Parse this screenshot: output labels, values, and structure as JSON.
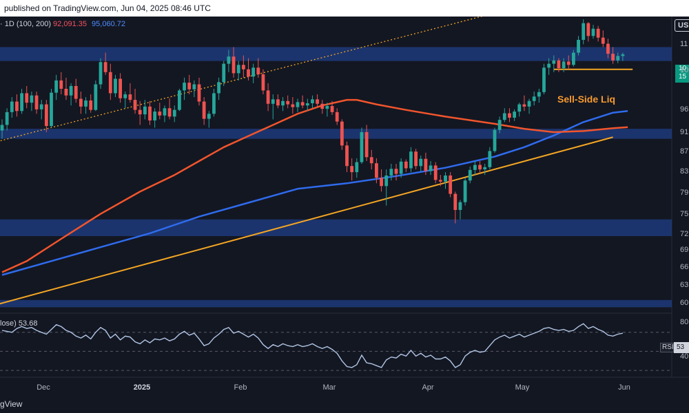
{
  "header": {
    "text": "published on TradingView.com, Jun 04, 2025 08:46 UTC"
  },
  "footer": {
    "text": "gView"
  },
  "legend": {
    "prefix": "· 1D (100, 200)",
    "ma100": "92,091.35",
    "ma200": "95,060.72"
  },
  "currency": "US",
  "price_tag": {
    "line1": "10",
    "line2": "15"
  },
  "annotation": "Sell-Side Liq",
  "rsi": {
    "legend_label": "lose)",
    "legend_value": "53.68",
    "tag": "RSI",
    "value": "53"
  },
  "colors": {
    "bg": "#131722",
    "zone": "#1e3a7a",
    "ma100": "#f2552c",
    "ma200": "#2f6bed",
    "trend": "#f5a623",
    "up": "#26a69a",
    "down": "#ef5350",
    "rsi_line": "#b2c7e6"
  },
  "chart_data": [
    {
      "type": "candlestick",
      "title": "",
      "x_tick_labels": [
        "Dec",
        "2025",
        "Feb",
        "Mar",
        "Apr",
        "May",
        "Jun"
      ],
      "y_tick_labels": [
        "11",
        "10",
        "96",
        "91",
        "87",
        "83",
        "79",
        "75",
        "72",
        "69",
        "66",
        "63",
        "60"
      ],
      "ylim": [
        59000,
        112000
      ],
      "zones": [
        {
          "from": 104000,
          "to": 106500
        },
        {
          "from": 90000,
          "to": 91800
        },
        {
          "from": 72500,
          "to": 75500
        },
        {
          "from": 59700,
          "to": 61000
        }
      ],
      "ohlc": [
        [
          91500,
          93500,
          90000,
          92500
        ],
        [
          92500,
          95500,
          91500,
          94800
        ],
        [
          94800,
          97500,
          93800,
          96700
        ],
        [
          96700,
          98000,
          94000,
          95000
        ],
        [
          95000,
          99000,
          94500,
          98200
        ],
        [
          98200,
          99500,
          95500,
          96500
        ],
        [
          96500,
          98500,
          95000,
          97800
        ],
        [
          97800,
          98500,
          94500,
          95300
        ],
        [
          95300,
          97000,
          93500,
          96200
        ],
        [
          96200,
          97000,
          91200,
          92300
        ],
        [
          92300,
          99000,
          92000,
          98300
        ],
        [
          98300,
          101500,
          97000,
          100500
        ],
        [
          100500,
          102000,
          98000,
          99000
        ],
        [
          99000,
          101000,
          97000,
          97800
        ],
        [
          97800,
          100000,
          96000,
          99500
        ],
        [
          99500,
          100800,
          96500,
          97200
        ],
        [
          97200,
          98500,
          94500,
          95800
        ],
        [
          95800,
          97500,
          94500,
          96900
        ],
        [
          96900,
          98000,
          94700,
          95200
        ],
        [
          95200,
          100500,
          95000,
          99800
        ],
        [
          99800,
          104500,
          99000,
          103800
        ],
        [
          103800,
          105500,
          101500,
          102000
        ],
        [
          102000,
          103500,
          97000,
          98200
        ],
        [
          98200,
          101500,
          97500,
          100800
        ],
        [
          100800,
          101800,
          96500,
          97300
        ],
        [
          97300,
          98500,
          95500,
          98000
        ],
        [
          98000,
          100000,
          96500,
          97000
        ],
        [
          97000,
          99000,
          94500,
          95200
        ],
        [
          95200,
          96800,
          92500,
          94400
        ],
        [
          94400,
          97000,
          93500,
          95800
        ],
        [
          95800,
          96800,
          92500,
          93300
        ],
        [
          93300,
          95500,
          92000,
          94900
        ],
        [
          94900,
          96500,
          93500,
          94200
        ],
        [
          94200,
          96000,
          93000,
          95500
        ],
        [
          95500,
          97300,
          93500,
          94000
        ],
        [
          94000,
          96000,
          93000,
          95200
        ],
        [
          95200,
          99000,
          95000,
          98700
        ],
        [
          98700,
          101000,
          97000,
          100100
        ],
        [
          100100,
          101500,
          98000,
          98900
        ],
        [
          98900,
          100500,
          97500,
          99800
        ],
        [
          99800,
          101000,
          96000,
          96700
        ],
        [
          96700,
          97500,
          92500,
          93600
        ],
        [
          93600,
          95000,
          92000,
          94500
        ],
        [
          94500,
          99000,
          94000,
          98200
        ],
        [
          98200,
          101000,
          97000,
          100200
        ],
        [
          100200,
          104000,
          99500,
          103500
        ],
        [
          103500,
          106000,
          102000,
          104800
        ],
        [
          104800,
          106500,
          101000,
          101800
        ],
        [
          101800,
          104000,
          100500,
          103300
        ],
        [
          103300,
          105000,
          101000,
          102500
        ],
        [
          102500,
          104500,
          100500,
          101200
        ],
        [
          101200,
          103500,
          100000,
          102800
        ],
        [
          102800,
          104500,
          101000,
          101600
        ],
        [
          101600,
          102500,
          98000,
          98700
        ],
        [
          98700,
          100000,
          95000,
          96300
        ],
        [
          96300,
          98000,
          93500,
          97100
        ],
        [
          97100,
          98000,
          95500,
          96000
        ],
        [
          96000,
          97500,
          95000,
          96800
        ],
        [
          96800,
          97800,
          95500,
          96200
        ],
        [
          96200,
          97500,
          94500,
          95700
        ],
        [
          95700,
          97200,
          94800,
          96600
        ],
        [
          96600,
          97800,
          95500,
          96000
        ],
        [
          96000,
          97200,
          95000,
          96400
        ],
        [
          96400,
          97800,
          95500,
          97100
        ],
        [
          97100,
          98000,
          95800,
          96300
        ],
        [
          96300,
          97000,
          94500,
          95400
        ],
        [
          95400,
          96500,
          94000,
          95900
        ],
        [
          95900,
          96800,
          94300,
          94800
        ],
        [
          94800,
          95500,
          92500,
          93100
        ],
        [
          93100,
          93500,
          88000,
          88800
        ],
        [
          88800,
          89500,
          84000,
          85100
        ],
        [
          85100,
          86500,
          82500,
          84000
        ],
        [
          84000,
          86500,
          83000,
          85800
        ],
        [
          85800,
          92000,
          85500,
          91200
        ],
        [
          91200,
          92500,
          86000,
          86700
        ],
        [
          86700,
          88000,
          84500,
          85600
        ],
        [
          85600,
          86500,
          82000,
          83000
        ],
        [
          83000,
          84500,
          80500,
          81500
        ],
        [
          81500,
          84500,
          78000,
          83400
        ],
        [
          83400,
          85500,
          82500,
          84600
        ],
        [
          84600,
          85500,
          82500,
          83700
        ],
        [
          83700,
          86500,
          83000,
          85900
        ],
        [
          85900,
          86300,
          84000,
          84700
        ],
        [
          84700,
          88500,
          84000,
          87700
        ],
        [
          87700,
          88200,
          84500,
          85100
        ],
        [
          85100,
          87000,
          84200,
          86400
        ],
        [
          86400,
          87500,
          83500,
          84200
        ],
        [
          84200,
          86000,
          83500,
          85200
        ],
        [
          85200,
          85800,
          82000,
          82600
        ],
        [
          82600,
          83500,
          81500,
          82300
        ],
        [
          82300,
          84000,
          81000,
          83400
        ],
        [
          83400,
          84000,
          79500,
          80100
        ],
        [
          80100,
          80500,
          74800,
          77200
        ],
        [
          77200,
          79000,
          75500,
          78600
        ],
        [
          78600,
          83000,
          78000,
          82500
        ],
        [
          82500,
          85000,
          82000,
          84400
        ],
        [
          84400,
          86000,
          83500,
          85300
        ],
        [
          85300,
          86000,
          83800,
          84500
        ],
        [
          84500,
          85500,
          83500,
          84900
        ],
        [
          84900,
          88500,
          84500,
          87800
        ],
        [
          87800,
          92000,
          87500,
          91600
        ],
        [
          91600,
          94000,
          91000,
          93400
        ],
        [
          93400,
          95500,
          93000,
          94600
        ],
        [
          94600,
          95500,
          93000,
          93800
        ],
        [
          93800,
          95300,
          93200,
          94900
        ],
        [
          94900,
          96500,
          94000,
          96200
        ],
        [
          96200,
          97800,
          95000,
          95800
        ],
        [
          95800,
          97200,
          94500,
          96800
        ],
        [
          96800,
          98500,
          96000,
          97600
        ],
        [
          97600,
          99000,
          96500,
          98400
        ],
        [
          98400,
          103500,
          98000,
          102800
        ],
        [
          102800,
          104500,
          101500,
          103500
        ],
        [
          103500,
          105000,
          102000,
          104100
        ],
        [
          104100,
          104500,
          102000,
          102700
        ],
        [
          102700,
          104500,
          102000,
          103900
        ],
        [
          103900,
          105000,
          102500,
          103300
        ],
        [
          103300,
          106000,
          103000,
          105500
        ],
        [
          105500,
          108500,
          105000,
          107800
        ],
        [
          107800,
          111500,
          107000,
          110800
        ],
        [
          110800,
          111000,
          107500,
          108500
        ],
        [
          108500,
          110500,
          108000,
          109800
        ],
        [
          109800,
          110300,
          107500,
          108200
        ],
        [
          108200,
          109500,
          106500,
          107100
        ],
        [
          107100,
          108000,
          104500,
          105300
        ],
        [
          105300,
          106500,
          103500,
          104100
        ],
        [
          104100,
          105500,
          103600,
          104900
        ],
        [
          104900,
          105500,
          104000,
          105200
        ]
      ],
      "ma100": [
        [
          0,
          66000
        ],
        [
          5,
          68000
        ],
        [
          12,
          72000
        ],
        [
          20,
          76500
        ],
        [
          28,
          80500
        ],
        [
          35,
          83500
        ],
        [
          40,
          86000
        ],
        [
          45,
          88500
        ],
        [
          50,
          90500
        ],
        [
          55,
          92500
        ],
        [
          60,
          94500
        ],
        [
          65,
          96000
        ],
        [
          70,
          97000
        ],
        [
          72,
          97000
        ],
        [
          76,
          96200
        ],
        [
          82,
          95200
        ],
        [
          90,
          94000
        ],
        [
          100,
          92700
        ],
        [
          106,
          91800
        ],
        [
          112,
          91200
        ],
        [
          118,
          91400
        ],
        [
          124,
          91900
        ],
        [
          127,
          92100
        ]
      ],
      "ma200": [
        [
          0,
          65500
        ],
        [
          10,
          68000
        ],
        [
          20,
          70500
        ],
        [
          30,
          73000
        ],
        [
          40,
          76000
        ],
        [
          50,
          78500
        ],
        [
          60,
          81000
        ],
        [
          70,
          82000
        ],
        [
          80,
          83300
        ],
        [
          90,
          84800
        ],
        [
          100,
          86800
        ],
        [
          106,
          88500
        ],
        [
          112,
          90600
        ],
        [
          118,
          93000
        ],
        [
          124,
          94700
        ],
        [
          127,
          95000
        ]
      ],
      "trendlines": [
        {
          "style": "solid",
          "points": [
            [
              -1,
              60200
            ],
            [
              124,
              90300
            ]
          ]
        },
        {
          "style": "dotted",
          "points": [
            [
              -1,
              89500
            ],
            [
              106,
              114000
            ]
          ]
        },
        {
          "style": "solid",
          "points": [
            [
              112,
              102500
            ],
            [
              128,
              102500
            ]
          ]
        }
      ]
    },
    {
      "type": "line",
      "title": "RSI",
      "y_tick_labels": [
        "80",
        "40"
      ],
      "ylim": [
        25,
        85
      ],
      "levels": [
        70,
        50,
        30
      ],
      "values": [
        72,
        71,
        70,
        74,
        76,
        74,
        75,
        72,
        70,
        68,
        73,
        78,
        76,
        72,
        70,
        66,
        64,
        67,
        63,
        70,
        75,
        72,
        64,
        68,
        62,
        66,
        65,
        60,
        58,
        62,
        59,
        63,
        62,
        64,
        61,
        63,
        68,
        71,
        67,
        69,
        63,
        56,
        58,
        64,
        68,
        73,
        75,
        69,
        71,
        68,
        65,
        68,
        64,
        57,
        53,
        57,
        55,
        58,
        56,
        55,
        57,
        55,
        56,
        58,
        55,
        53,
        55,
        52,
        48,
        40,
        34,
        33,
        36,
        46,
        38,
        37,
        35,
        33,
        41,
        44,
        43,
        47,
        45,
        51,
        45,
        48,
        44,
        46,
        42,
        42,
        44,
        40,
        33,
        36,
        45,
        49,
        51,
        49,
        50,
        56,
        62,
        65,
        67,
        64,
        66,
        68,
        65,
        67,
        69,
        71,
        74,
        75,
        73,
        72,
        73,
        71,
        72,
        76,
        79,
        74,
        76,
        73,
        71,
        67,
        66,
        68,
        69
      ]
    }
  ]
}
